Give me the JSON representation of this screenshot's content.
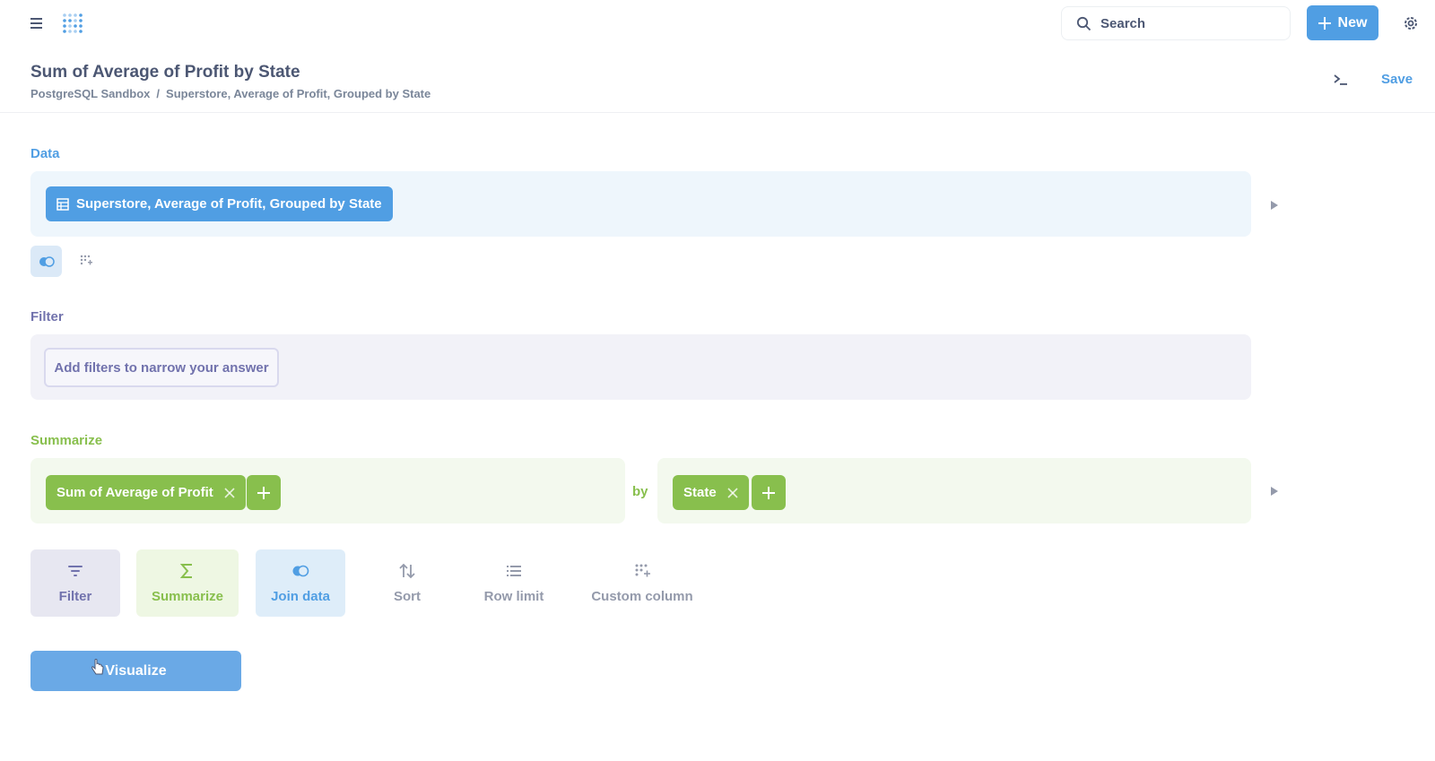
{
  "nav": {
    "search_label": "Search",
    "new_label": "New"
  },
  "header": {
    "title": "Sum of Average of Profit by State",
    "breadcrumb": [
      "PostgreSQL Sandbox",
      "/",
      "Superstore, Average of Profit, Grouped by State"
    ],
    "save_label": "Save"
  },
  "data_section": {
    "label": "Data",
    "source": "Superstore, Average of Profit, Grouped by State"
  },
  "filter_section": {
    "label": "Filter",
    "placeholder": "Add filters to narrow your answer"
  },
  "summarize_section": {
    "label": "Summarize",
    "metric": "Sum of Average of Profit",
    "by_label": "by",
    "breakout": "State"
  },
  "actions": {
    "filter": "Filter",
    "summarize": "Summarize",
    "join": "Join data",
    "sort": "Sort",
    "row_limit": "Row limit",
    "custom_column": "Custom column"
  },
  "visualize_label": "Visualize",
  "colors": {
    "brand": "#509ee3",
    "filter": "#7172ad",
    "summarize": "#88bf4d"
  },
  "icons": [
    "hamburger-icon",
    "metabase-logo",
    "search-icon",
    "plus-icon",
    "gear-icon",
    "console-icon",
    "table-icon",
    "join-icon",
    "custom-column-icon",
    "close-icon",
    "filter-icon",
    "sigma-icon",
    "sort-icon",
    "list-icon",
    "play-arrow-icon"
  ]
}
